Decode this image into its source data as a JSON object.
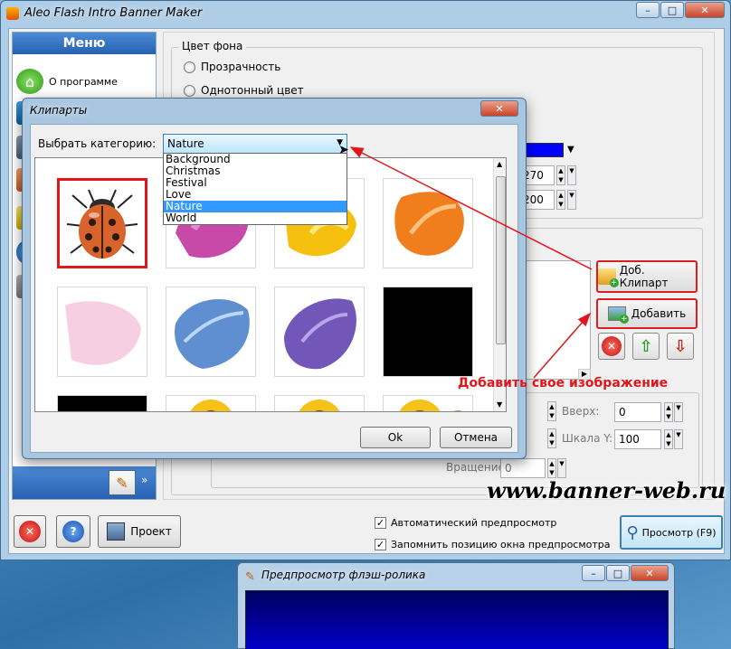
{
  "main_window": {
    "title": "Aleo Flash Intro Banner Maker"
  },
  "menu": {
    "header": "Меню",
    "about_label": "О программе"
  },
  "background": {
    "group_title": "Цвет фона",
    "transparency_label": "Прозрачность",
    "solid_color_label": "Однотонный цвет",
    "width_value": "270",
    "height_value": "200"
  },
  "images": {
    "add_clipart_label": "Доб. Клипарт",
    "add_label": "Добавить",
    "up_label": "Вверх:",
    "up_value": "0",
    "scale_y_label": "Шкала Y:",
    "scale_y_value": "100",
    "rotation_label": "Вращение",
    "rotation_value": "0"
  },
  "bottom_bar": {
    "project_label": "Проект",
    "auto_preview_label": "Автоматический предпросмотр",
    "remember_pos_label": "Запомнить позицию окна предпросмотра",
    "preview_label": "Просмотр (F9)"
  },
  "clipart_dialog": {
    "title": "Клипарты",
    "category_label": "Выбрать категорию:",
    "selected_category": "Nature",
    "categories": [
      "Background",
      "Christmas",
      "Festival",
      "Love",
      "Nature",
      "World"
    ],
    "ok_label": "Ok",
    "cancel_label": "Отмена"
  },
  "preview_window": {
    "title": "Предпросмотр флэш-ролика"
  },
  "annotations": {
    "add_own_image": "Добавить свое изображение",
    "watermark": "www.banner-web.ru"
  },
  "colors": {
    "accent": "#2760b0",
    "highlight": "#d9201f",
    "selection": "#3399ff",
    "swatch": "#0000ff"
  },
  "icons": [
    "home-icon",
    "ladybug-icon",
    "folder-add-icon",
    "image-add-icon",
    "delete-icon",
    "arrow-up-icon",
    "arrow-down-icon",
    "help-icon",
    "save-icon",
    "magnifier-icon",
    "pencil-icon"
  ]
}
